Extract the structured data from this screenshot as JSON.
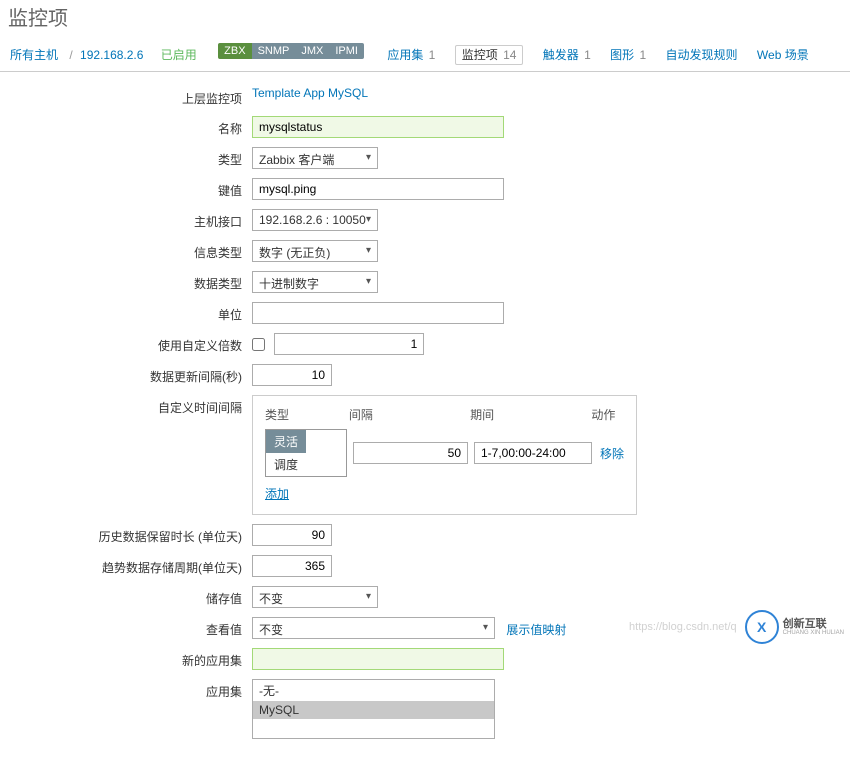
{
  "page": {
    "title": "监控项"
  },
  "nav": {
    "all_hosts": "所有主机",
    "host_ip": "192.168.2.6",
    "enabled": "已启用",
    "pills": [
      "ZBX",
      "SNMP",
      "JMX",
      "IPMI"
    ],
    "tabs": {
      "app_set": {
        "label": "应用集",
        "count": "1"
      },
      "items": {
        "label": "监控项",
        "count": "14"
      },
      "triggers": {
        "label": "触发器",
        "count": "1"
      },
      "graphs": {
        "label": "图形",
        "count": "1"
      },
      "discovery": {
        "label": "自动发现规则"
      },
      "web": {
        "label": "Web 场景"
      }
    }
  },
  "form": {
    "parent_label": "上层监控项",
    "parent_value": "Template App MySQL",
    "name_label": "名称",
    "name_value": "mysqlstatus",
    "type_label": "类型",
    "type_value": "Zabbix 客户端",
    "key_label": "键值",
    "key_value": "mysql.ping",
    "host_if_label": "主机接口",
    "host_if_value": "192.168.2.6 : 10050",
    "info_type_label": "信息类型",
    "info_type_value": "数字 (无正负)",
    "data_type_label": "数据类型",
    "data_type_value": "十进制数字",
    "unit_label": "单位",
    "unit_value": "",
    "custom_mult_label": "使用自定义倍数",
    "custom_mult_value": "1",
    "update_interval_label": "数据更新间隔(秒)",
    "update_interval_value": "10",
    "flex_interval_label": "自定义时间间隔",
    "flex_headers": {
      "type": "类型",
      "interval": "间隔",
      "period": "期间",
      "action": "动作"
    },
    "flex_toggle": {
      "active": "灵活",
      "scheduled": "调度"
    },
    "flex_interval_value": "50",
    "flex_period_value": "1-7,00:00-24:00",
    "flex_remove": "移除",
    "flex_add": "添加",
    "history_label": "历史数据保留时长 (单位天)",
    "history_value": "90",
    "trend_label": "趋势数据存储周期(单位天)",
    "trend_value": "365",
    "store_value_label": "储存值",
    "store_value_value": "不变",
    "show_value_label": "查看值",
    "show_value_value": "不变",
    "show_value_link": "展示值映射",
    "new_app_label": "新的应用集",
    "new_app_value": "",
    "apps_label": "应用集",
    "apps_options": [
      "-无-",
      "MySQL"
    ],
    "apps_selected": "MySQL"
  },
  "watermark": {
    "faint": "https://blog.csdn.net/q",
    "brand1": "创新互联",
    "brand2": "CHUANG XIN HULIAN"
  }
}
